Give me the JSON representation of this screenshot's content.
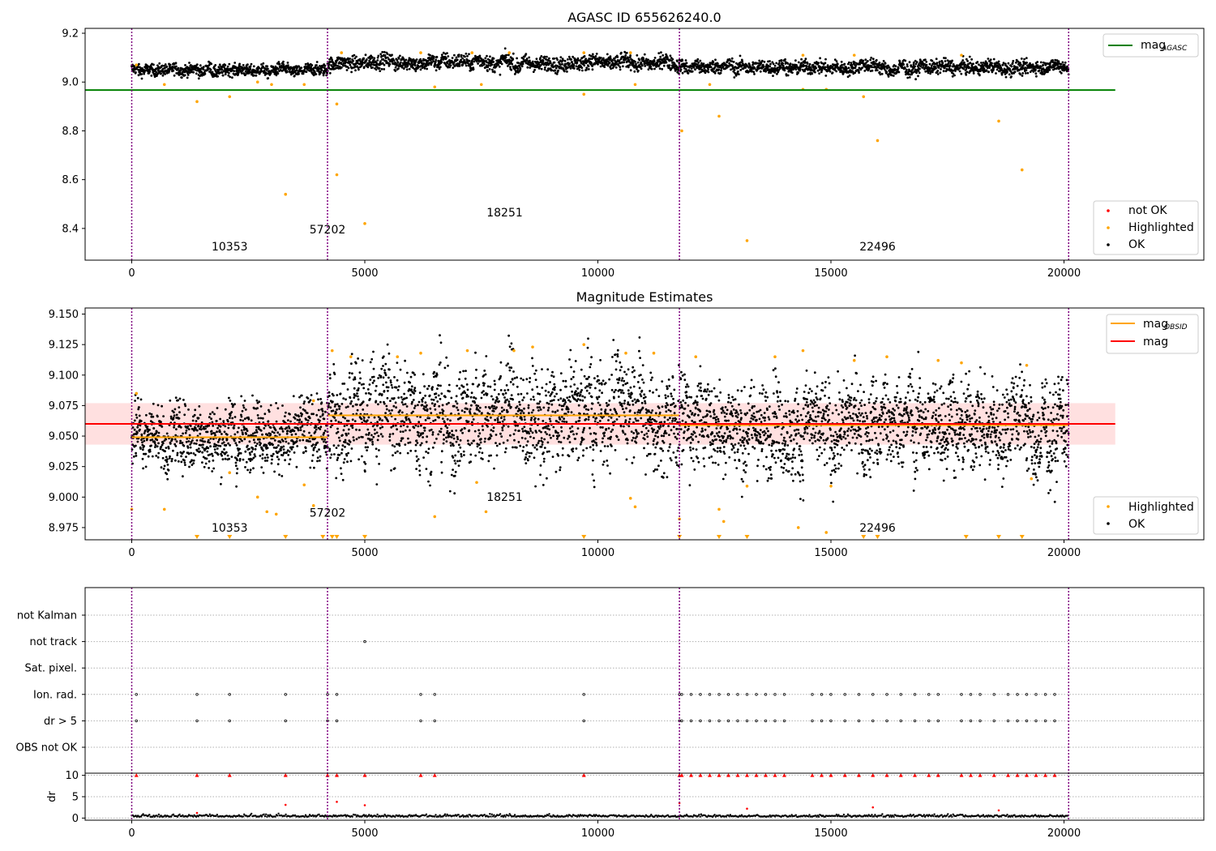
{
  "chart_data": [
    {
      "type": "scatter",
      "title": "AGASC ID 655626240.0",
      "xlim": [
        -1000,
        23000
      ],
      "ylim": [
        8.27,
        9.22
      ],
      "xticks": [
        0,
        5000,
        10000,
        15000,
        20000
      ],
      "xtick_labels": [
        "0",
        "5000",
        "10000",
        "15000",
        "20000"
      ],
      "yticks": [
        8.4,
        8.6,
        8.8,
        9.0,
        9.2
      ],
      "ytick_labels": [
        "8.4",
        "8.6",
        "8.8",
        "9.0",
        "9.2"
      ],
      "obsid_boundaries": [
        0,
        4200,
        11750,
        20100
      ],
      "obsid_labels": [
        {
          "text": "10353",
          "x": 2100,
          "y": 8.31
        },
        {
          "text": "57202",
          "x": 4200,
          "y": 8.38
        },
        {
          "text": "18251",
          "x": 8000,
          "y": 8.45
        },
        {
          "text": "22496",
          "x": 16000,
          "y": 8.31
        }
      ],
      "mag_agasc": {
        "value": 8.967,
        "x_range": [
          -1000,
          21100
        ],
        "color": "#008000"
      },
      "ok_segments": [
        {
          "x_range": [
            0,
            4200
          ],
          "center": 9.05,
          "spread": 0.012
        },
        {
          "x_range": [
            4200,
            11750
          ],
          "center": 9.08,
          "spread": 0.015
        },
        {
          "x_range": [
            11750,
            20100
          ],
          "center": 9.06,
          "spread": 0.014
        }
      ],
      "highlighted_points": [
        [
          100,
          9.07
        ],
        [
          700,
          8.99
        ],
        [
          1400,
          8.92
        ],
        [
          2100,
          8.94
        ],
        [
          2700,
          9.0
        ],
        [
          3000,
          8.99
        ],
        [
          3300,
          8.54
        ],
        [
          3700,
          8.99
        ],
        [
          4400,
          8.91
        ],
        [
          4400,
          8.62
        ],
        [
          5000,
          8.42
        ],
        [
          6500,
          8.98
        ],
        [
          7500,
          8.99
        ],
        [
          9700,
          8.95
        ],
        [
          10800,
          8.99
        ],
        [
          11800,
          8.8
        ],
        [
          12400,
          8.99
        ],
        [
          12600,
          8.86
        ],
        [
          13200,
          8.35
        ],
        [
          14400,
          8.97
        ],
        [
          14900,
          8.97
        ],
        [
          15700,
          8.94
        ],
        [
          16000,
          8.76
        ],
        [
          18600,
          8.84
        ],
        [
          19100,
          8.64
        ],
        [
          4500,
          9.12
        ],
        [
          6200,
          9.12
        ],
        [
          7300,
          9.12
        ],
        [
          8100,
          9.12
        ],
        [
          9700,
          9.12
        ],
        [
          10700,
          9.12
        ],
        [
          14400,
          9.11
        ],
        [
          15500,
          9.11
        ],
        [
          17800,
          9.11
        ]
      ],
      "legends": [
        {
          "position": "upper right",
          "items": [
            {
              "label": "mag",
              "subscript": "AGASC",
              "color": "#008000",
              "marker": "line"
            }
          ]
        },
        {
          "position": "lower right",
          "items": [
            {
              "label": "not OK",
              "color": "#ff0000",
              "marker": "dot"
            },
            {
              "label": "Highlighted",
              "color": "#ffa500",
              "marker": "dot"
            },
            {
              "label": "OK",
              "color": "#000000",
              "marker": "dot"
            }
          ]
        }
      ]
    },
    {
      "type": "scatter",
      "title": "Magnitude Estimates",
      "xlim": [
        -1000,
        23000
      ],
      "ylim": [
        8.965,
        9.155
      ],
      "xticks": [
        0,
        5000,
        10000,
        15000,
        20000
      ],
      "xtick_labels": [
        "0",
        "5000",
        "10000",
        "15000",
        "20000"
      ],
      "yticks": [
        8.975,
        9.0,
        9.025,
        9.05,
        9.075,
        9.1,
        9.125,
        9.15
      ],
      "ytick_labels": [
        "8.975",
        "9.000",
        "9.025",
        "9.050",
        "9.075",
        "9.100",
        "9.125",
        "9.150"
      ],
      "obsid_boundaries": [
        0,
        4200,
        11750,
        20100
      ],
      "obsid_labels": [
        {
          "text": "10353",
          "x": 2100,
          "y": 8.9715
        },
        {
          "text": "57202",
          "x": 4200,
          "y": 8.984
        },
        {
          "text": "18251",
          "x": 8000,
          "y": 8.997
        },
        {
          "text": "22496",
          "x": 16000,
          "y": 8.9715
        }
      ],
      "mag": {
        "value": 9.06,
        "band": [
          9.043,
          9.077
        ],
        "x_range": [
          -1000,
          21100
        ],
        "color": "#ff0000"
      },
      "mag_obsid": [
        {
          "x_range": [
            0,
            4200
          ],
          "value": 9.049
        },
        {
          "x_range": [
            4200,
            11750
          ],
          "value": 9.067
        },
        {
          "x_range": [
            11750,
            20100
          ],
          "value": 9.059
        }
      ],
      "ok_segments": [
        {
          "x_range": [
            0,
            4200
          ],
          "center": 9.05,
          "spread": 0.013
        },
        {
          "x_range": [
            4200,
            11750
          ],
          "center": 9.067,
          "spread": 0.02
        },
        {
          "x_range": [
            11750,
            20100
          ],
          "center": 9.058,
          "spread": 0.018
        }
      ],
      "highlighted_points": [
        [
          0,
          8.99
        ],
        [
          100,
          9.085
        ],
        [
          700,
          8.99
        ],
        [
          2100,
          9.02
        ],
        [
          2700,
          9.0
        ],
        [
          2900,
          8.988
        ],
        [
          3100,
          8.986
        ],
        [
          3700,
          9.01
        ],
        [
          3900,
          8.993
        ],
        [
          3900,
          9.079
        ],
        [
          4300,
          9.12
        ],
        [
          4700,
          9.115
        ],
        [
          5700,
          9.115
        ],
        [
          6200,
          9.118
        ],
        [
          6500,
          8.984
        ],
        [
          7200,
          9.12
        ],
        [
          7400,
          9.012
        ],
        [
          7600,
          8.988
        ],
        [
          8200,
          9.12
        ],
        [
          8600,
          9.123
        ],
        [
          9700,
          9.125
        ],
        [
          10700,
          8.999
        ],
        [
          10800,
          8.992
        ],
        [
          10600,
          9.118
        ],
        [
          11200,
          9.118
        ],
        [
          11750,
          8.982
        ],
        [
          12100,
          9.115
        ],
        [
          12600,
          8.99
        ],
        [
          12700,
          8.98
        ],
        [
          13200,
          9.009
        ],
        [
          13800,
          9.115
        ],
        [
          14300,
          8.975
        ],
        [
          14400,
          9.12
        ],
        [
          14900,
          8.971
        ],
        [
          15000,
          9.009
        ],
        [
          15500,
          9.112
        ],
        [
          16200,
          9.115
        ],
        [
          17300,
          9.112
        ],
        [
          17800,
          9.11
        ],
        [
          19200,
          9.108
        ],
        [
          19300,
          9.015
        ]
      ],
      "clipped_markers_x": [
        1400,
        2100,
        3300,
        4100,
        4300,
        4400,
        5000,
        9700,
        11750,
        12600,
        13200,
        15700,
        16000,
        17900,
        18600,
        19100
      ],
      "legends": [
        {
          "position": "upper right",
          "items": [
            {
              "label": "mag",
              "subscript": "OBSID",
              "color": "#ffa500",
              "marker": "line"
            },
            {
              "label": "mag",
              "subscript": "",
              "color": "#ff0000",
              "marker": "line"
            }
          ]
        },
        {
          "position": "lower right",
          "items": [
            {
              "label": "Highlighted",
              "color": "#ffa500",
              "marker": "dot"
            },
            {
              "label": "OK",
              "color": "#000000",
              "marker": "dot"
            }
          ]
        }
      ]
    },
    {
      "type": "scatter",
      "title": "",
      "xlim": [
        -1000,
        23000
      ],
      "xticks": [
        0,
        5000,
        10000,
        15000,
        20000
      ],
      "xtick_labels": [
        "0",
        "5000",
        "10000",
        "15000",
        "20000"
      ],
      "categories": [
        "not Kalman",
        "not track",
        "Sat. pixel.",
        "Ion. rad.",
        "dr > 5",
        "OBS not OK"
      ],
      "obsid_boundaries": [
        0,
        4200,
        11750,
        20100
      ],
      "flag_points": {
        "not track": [
          5000
        ],
        "Ion. rad.": [
          100,
          1400,
          2100,
          3300,
          4200,
          4400,
          6200,
          6500,
          9700,
          11750,
          11800,
          12000,
          12200,
          12400,
          12600,
          12800,
          13000,
          13200,
          13400,
          13600,
          13800,
          14000,
          14600,
          14800,
          15000,
          15300,
          15600,
          15900,
          16200,
          16500,
          16800,
          17100,
          17300,
          17800,
          18000,
          18200,
          18500,
          18800,
          19000,
          19200,
          19400,
          19600,
          19800
        ],
        "dr > 5": [
          100,
          1400,
          2100,
          3300,
          4200,
          4400,
          6200,
          6500,
          9700,
          11750,
          11800,
          12000,
          12200,
          12400,
          12600,
          12800,
          13000,
          13200,
          13400,
          13600,
          13800,
          14000,
          14600,
          14800,
          15000,
          15300,
          15600,
          15900,
          16200,
          16500,
          16800,
          17100,
          17300,
          17800,
          18000,
          18200,
          18500,
          18800,
          19000,
          19200,
          19400,
          19600,
          19800
        ]
      },
      "dr_axis": {
        "ylabel": "dr",
        "ylim": [
          -0.5,
          10.5
        ],
        "yticks": [
          0,
          5,
          10
        ],
        "ytick_labels": [
          "0",
          "5",
          "10"
        ],
        "baseline": 0.3,
        "clipped_red_x": [
          100,
          1400,
          2100,
          3300,
          4200,
          4400,
          5000,
          6200,
          6500,
          9700,
          11750,
          11800,
          12000,
          12200,
          12400,
          12600,
          12800,
          13000,
          13200,
          13400,
          13600,
          13800,
          14000,
          14600,
          14800,
          15000,
          15300,
          15600,
          15900,
          16200,
          16500,
          16800,
          17100,
          17300,
          17800,
          18000,
          18200,
          18500,
          18800,
          19000,
          19200,
          19400,
          19600,
          19800
        ],
        "outliers": [
          [
            1400,
            1.2
          ],
          [
            3300,
            3.1
          ],
          [
            4400,
            3.8
          ],
          [
            5000,
            3.0
          ],
          [
            11750,
            3.5
          ],
          [
            13200,
            2.2
          ],
          [
            15900,
            2.5
          ],
          [
            18600,
            1.8
          ]
        ]
      }
    }
  ]
}
